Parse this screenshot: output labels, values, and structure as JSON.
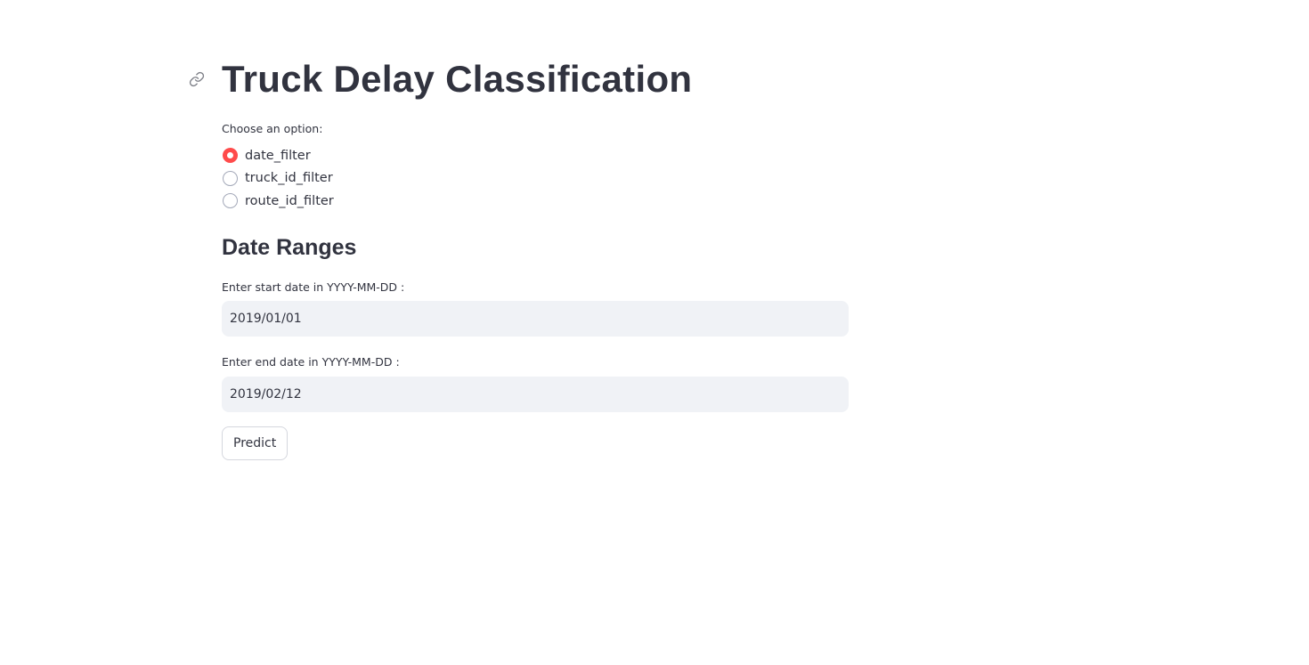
{
  "header": {
    "title": "Truck Delay Classification",
    "anchor_icon": "link-icon"
  },
  "option_selector": {
    "label": "Choose an option:",
    "options": [
      {
        "label": "date_filter",
        "selected": true
      },
      {
        "label": "truck_id_filter",
        "selected": false
      },
      {
        "label": "route_id_filter",
        "selected": false
      }
    ],
    "selected_color": "#ff4b4b"
  },
  "date_ranges": {
    "heading": "Date Ranges",
    "start_label": "Enter start date in YYYY-MM-DD :",
    "start_value": "2019/01/01",
    "end_label": "Enter end date in YYYY-MM-DD :",
    "end_value": "2019/02/12"
  },
  "actions": {
    "predict_label": "Predict"
  },
  "colors": {
    "text": "#31333f",
    "input_background": "#f0f2f6",
    "accent": "#ff4b4b"
  }
}
